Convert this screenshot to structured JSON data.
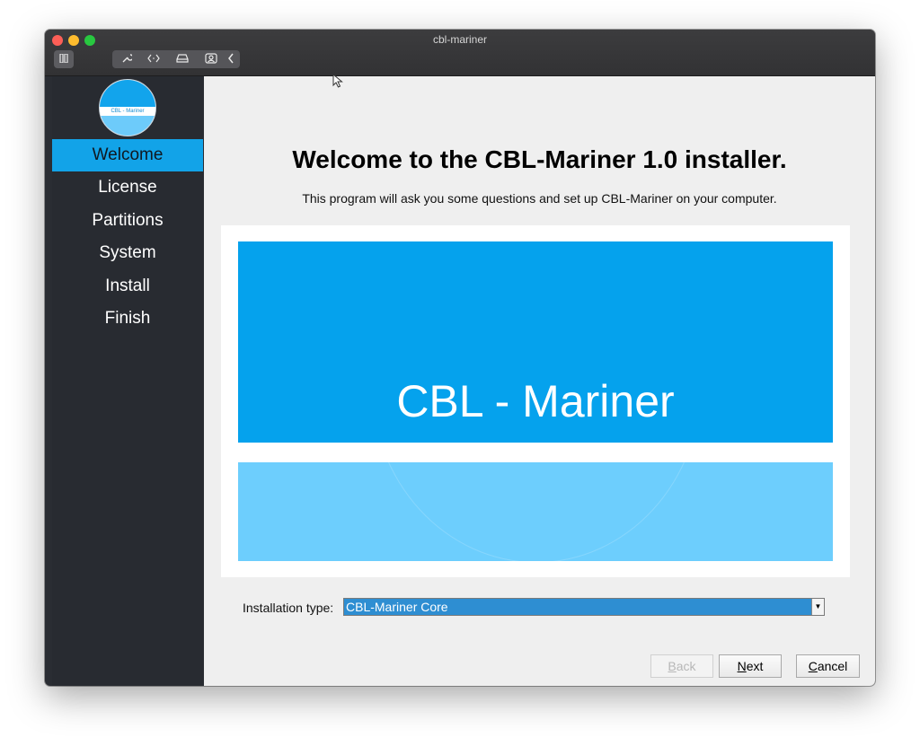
{
  "window": {
    "title": "cbl-mariner"
  },
  "toolbar": {
    "icons": [
      "pause-icon",
      "wrench-icon",
      "code-icon",
      "drive-icon",
      "user-icon",
      "chevron-left-icon"
    ]
  },
  "sidebar": {
    "logo_text": "CBL - Mariner",
    "items": [
      {
        "label": "Welcome",
        "active": true
      },
      {
        "label": "License",
        "active": false
      },
      {
        "label": "Partitions",
        "active": false
      },
      {
        "label": "System",
        "active": false
      },
      {
        "label": "Install",
        "active": false
      },
      {
        "label": "Finish",
        "active": false
      }
    ]
  },
  "main": {
    "title": "Welcome to the CBL-Mariner 1.0 installer.",
    "subtitle": "This program will ask you some questions and set up CBL-Mariner on your computer.",
    "banner_text": "CBL - Mariner",
    "installation_type": {
      "label": "Installation type:",
      "value": "CBL-Mariner Core"
    }
  },
  "buttons": {
    "back": {
      "first": "B",
      "rest": "ack",
      "enabled": false
    },
    "next": {
      "first": "N",
      "rest": "ext",
      "enabled": true
    },
    "cancel": {
      "first": "C",
      "rest": "ancel",
      "enabled": true
    }
  },
  "colors": {
    "accent": "#12a3e8",
    "banner_primary": "#05a2ed",
    "banner_secondary": "#6dcefd",
    "sidebar_bg": "#282b31",
    "select_highlight": "#2e8ed2"
  }
}
